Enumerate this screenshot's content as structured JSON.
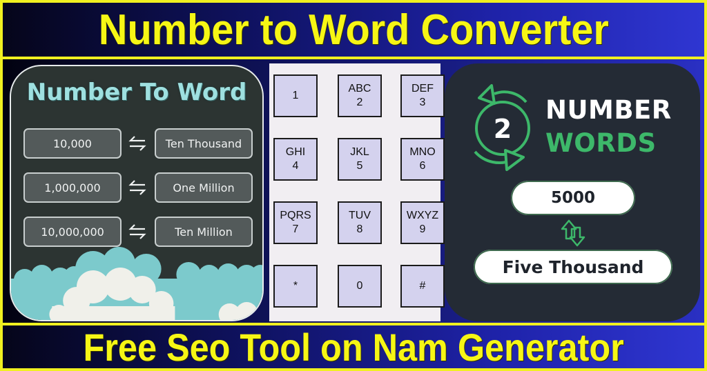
{
  "header": {
    "title": "Number to Word Converter"
  },
  "footer": {
    "title": "Free Seo Tool on Nam Generator"
  },
  "left_panel": {
    "title": "Number To Word",
    "swap_icon": "left-right-arrows-icon",
    "rows": [
      {
        "number": "10,000",
        "word": "Ten Thousand"
      },
      {
        "number": "1,000,000",
        "word": "One Million"
      },
      {
        "number": "10,000,000",
        "word": "Ten Million"
      }
    ],
    "decoration": "clouds"
  },
  "keypad": {
    "keys": [
      {
        "letters": "",
        "digit": "1"
      },
      {
        "letters": "ABC",
        "digit": "2"
      },
      {
        "letters": "DEF",
        "digit": "3"
      },
      {
        "letters": "GHI",
        "digit": "4"
      },
      {
        "letters": "JKL",
        "digit": "5"
      },
      {
        "letters": "MNO",
        "digit": "6"
      },
      {
        "letters": "PQRS",
        "digit": "7"
      },
      {
        "letters": "TUV",
        "digit": "8"
      },
      {
        "letters": "WXYZ",
        "digit": "9"
      },
      {
        "letters": "",
        "digit": "*"
      },
      {
        "letters": "",
        "digit": "0"
      },
      {
        "letters": "",
        "digit": "#"
      }
    ]
  },
  "right_panel": {
    "logo_icon": "circular-arrows-icon",
    "logo_digit": "2",
    "brand_line1": "NUMBER",
    "brand_line2": "WORDS",
    "input_value": "5000",
    "swap_icon": "up-down-arrows-icon",
    "output_value": "Five Thousand"
  },
  "colors": {
    "banner_text": "#f6f615",
    "frame": "#f0f020",
    "accent_green": "#3db86a",
    "cyan_title": "#9ee0e0",
    "key_fill": "#d4d2ee"
  }
}
